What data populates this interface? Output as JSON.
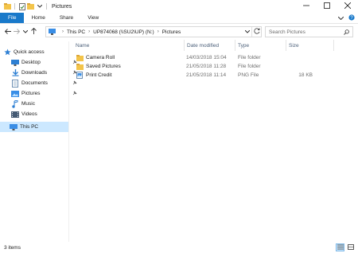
{
  "window": {
    "title": "Pictures",
    "controls": {
      "minimize": "minimize-icon",
      "maximize": "maximize-icon",
      "close": "close-icon"
    }
  },
  "ribbon": {
    "tabs": [
      {
        "label": "File",
        "active": true
      },
      {
        "label": "Home"
      },
      {
        "label": "Share"
      },
      {
        "label": "View"
      }
    ]
  },
  "address": {
    "breadcrumbs": [
      "This PC",
      "UP874068 (\\\\SU2\\UP) (N:)",
      "Pictures"
    ],
    "search_placeholder": "Search Pictures"
  },
  "nav": {
    "items": [
      {
        "label": "Quick access",
        "icon": "star-icon",
        "pinned": false
      },
      {
        "label": "Desktop",
        "icon": "desktop-icon",
        "pinned": true
      },
      {
        "label": "Downloads",
        "icon": "download-icon",
        "pinned": true
      },
      {
        "label": "Documents",
        "icon": "documents-icon",
        "pinned": true
      },
      {
        "label": "Pictures",
        "icon": "pictures-icon",
        "pinned": true
      },
      {
        "label": "Music",
        "icon": "music-icon",
        "pinned": false
      },
      {
        "label": "Videos",
        "icon": "videos-icon",
        "pinned": false
      },
      {
        "label": "This PC",
        "icon": "computer-icon",
        "pinned": false,
        "selected": true
      }
    ]
  },
  "columns": {
    "name": "Name",
    "date": "Date modified",
    "type": "Type",
    "size": "Size"
  },
  "files": [
    {
      "name": "Camera Roll",
      "date": "14/03/2018 15:04",
      "type": "File folder",
      "size": "",
      "icon": "folder-icon"
    },
    {
      "name": "Saved Pictures",
      "date": "21/05/2018 11:28",
      "type": "File folder",
      "size": "",
      "icon": "folder-icon"
    },
    {
      "name": "Print Credit",
      "date": "21/05/2018 11:14",
      "type": "PNG File",
      "size": "18 KB",
      "icon": "image-file-icon"
    }
  ],
  "status": {
    "item_count": "3 items"
  },
  "colors": {
    "accent": "#1979ca",
    "selection": "#cce8ff",
    "folder": "#f3c44a",
    "header_text": "#4c607a"
  }
}
